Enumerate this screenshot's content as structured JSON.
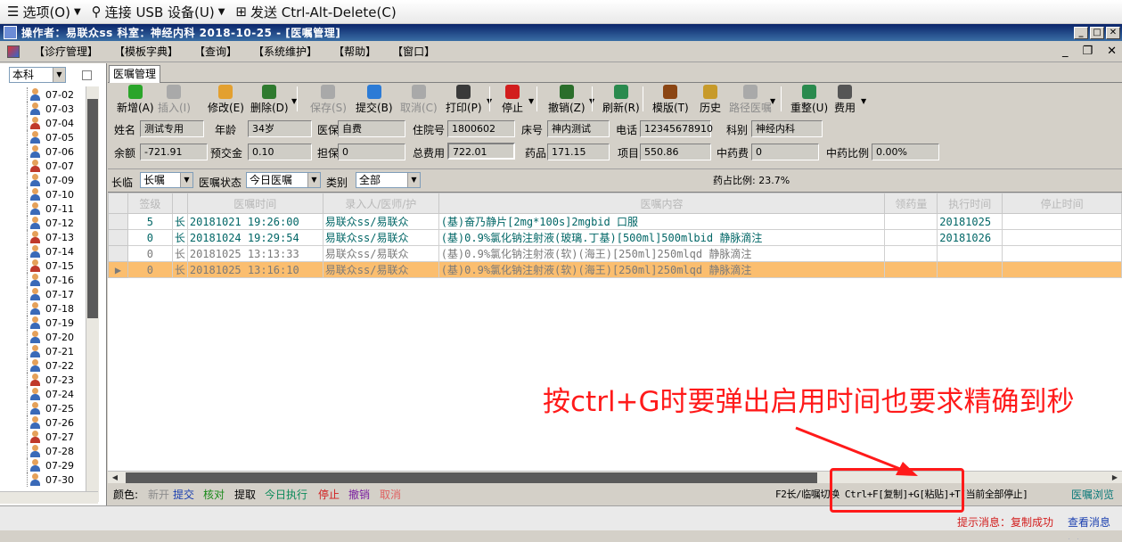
{
  "topbar": {
    "options_label": "选项(O)",
    "usb_label": "连接 USB 设备(U)",
    "send_label": "发送 Ctrl-Alt-Delete(C)"
  },
  "titlebar": {
    "text": "操作者：易联众ss  科室：神经内科  2018-10-25 - [医嘱管理]"
  },
  "menu": {
    "items": [
      "【诊疗管理】",
      "【模板字典】",
      "【查询】",
      "【系统维护】",
      "【帮助】",
      "【窗口】"
    ]
  },
  "left_panel": {
    "dept_combo": "本科",
    "items": [
      {
        "label": "07-02",
        "gender": "m"
      },
      {
        "label": "07-03",
        "gender": "m"
      },
      {
        "label": "07-04",
        "gender": "f"
      },
      {
        "label": "07-05",
        "gender": "m"
      },
      {
        "label": "07-06",
        "gender": "m"
      },
      {
        "label": "07-07",
        "gender": "f"
      },
      {
        "label": "07-09",
        "gender": "m"
      },
      {
        "label": "07-10",
        "gender": "m"
      },
      {
        "label": "07-11",
        "gender": "m"
      },
      {
        "label": "07-12",
        "gender": "m"
      },
      {
        "label": "07-13",
        "gender": "f"
      },
      {
        "label": "07-14",
        "gender": "m"
      },
      {
        "label": "07-15",
        "gender": "f"
      },
      {
        "label": "07-16",
        "gender": "m"
      },
      {
        "label": "07-17",
        "gender": "m"
      },
      {
        "label": "07-18",
        "gender": "m"
      },
      {
        "label": "07-19",
        "gender": "m"
      },
      {
        "label": "07-20",
        "gender": "m"
      },
      {
        "label": "07-21",
        "gender": "m"
      },
      {
        "label": "07-22",
        "gender": "m"
      },
      {
        "label": "07-23",
        "gender": "f"
      },
      {
        "label": "07-24",
        "gender": "m"
      },
      {
        "label": "07-25",
        "gender": "m"
      },
      {
        "label": "07-26",
        "gender": "m"
      },
      {
        "label": "07-27",
        "gender": "f"
      },
      {
        "label": "07-28",
        "gender": "m"
      },
      {
        "label": "07-29",
        "gender": "m"
      },
      {
        "label": "07-30",
        "gender": "m"
      }
    ]
  },
  "tab": {
    "label": "医嘱管理"
  },
  "toolbar": {
    "buttons": [
      {
        "label": "新增(A)",
        "icon": "add-icon",
        "color": "#2aa52a",
        "disabled": false,
        "drop": false
      },
      {
        "label": "插入(I)",
        "icon": "insert-icon",
        "color": "#a9a9a9",
        "disabled": true,
        "drop": false
      },
      {
        "label": "修改(E)",
        "icon": "edit-icon",
        "color": "#e3a030",
        "disabled": false,
        "drop": false
      },
      {
        "label": "删除(D)",
        "icon": "delete-icon",
        "color": "#2f7a2f",
        "disabled": false,
        "drop": true
      },
      {
        "label": "保存(S)",
        "icon": "save-icon",
        "color": "#a9a9a9",
        "disabled": true,
        "drop": false
      },
      {
        "label": "提交(B)",
        "icon": "submit-icon",
        "color": "#2c7bd6",
        "disabled": false,
        "drop": false
      },
      {
        "label": "取消(C)",
        "icon": "cancel-icon",
        "color": "#a9a9a9",
        "disabled": true,
        "drop": false
      },
      {
        "label": "打印(P)",
        "icon": "print-icon",
        "color": "#3a3a3a",
        "disabled": false,
        "drop": true
      },
      {
        "label": "停止",
        "icon": "stop-icon",
        "color": "#d21d1d",
        "disabled": false,
        "drop": true
      },
      {
        "label": "撤销(Z)",
        "icon": "undo-icon",
        "color": "#2b6e2b",
        "disabled": false,
        "drop": true
      },
      {
        "label": "刷新(R)",
        "icon": "refresh-icon",
        "color": "#2a8a4e",
        "disabled": false,
        "drop": false
      },
      {
        "label": "模版(T)",
        "icon": "template-icon",
        "color": "#8b4513",
        "disabled": false,
        "drop": false
      },
      {
        "label": "历史",
        "icon": "history-icon",
        "color": "#c79a2a",
        "disabled": false,
        "drop": false
      },
      {
        "label": "路径医嘱",
        "icon": "path-icon",
        "color": "#a9a9a9",
        "disabled": true,
        "drop": true
      },
      {
        "label": "重整(U)",
        "icon": "reorg-icon",
        "color": "#2a8a4e",
        "disabled": false,
        "drop": false
      },
      {
        "label": "费用",
        "icon": "fee-icon",
        "color": "#555555",
        "disabled": false,
        "drop": true
      }
    ]
  },
  "patient": {
    "name_label": "姓名",
    "name": "测试专用",
    "age_label": "年龄",
    "age": "34岁",
    "insurance_label": "医保",
    "insurance": "自费",
    "admission_label": "住院号",
    "admission": "1800602",
    "bed_label": "床号",
    "bed": "神内测试",
    "phone_label": "电话",
    "phone": "12345678910",
    "dept_label": "科别",
    "dept": "神经内科",
    "balance_label": "余额",
    "balance": "-721.91",
    "prepay_label": "预交金",
    "prepay": "0.10",
    "guarantee_label": "担保",
    "guarantee": "0",
    "total_label": "总费用",
    "total": "722.01",
    "drug_label": "药品",
    "drug": "171.15",
    "item_label": "项目",
    "item": "550.86",
    "tcm_label": "中药费",
    "tcm": "0",
    "tcm_ratio_label": "中药比例",
    "tcm_ratio": "0.00%"
  },
  "filters": {
    "type_label": "长临",
    "type_value": "长嘱",
    "status_label": "医嘱状态",
    "status_value": "今日医嘱",
    "category_label": "类别",
    "category_value": "全部",
    "ratio_text": "药占比例: 23.7%"
  },
  "grid": {
    "headers": [
      "签级",
      "医嘱时间",
      "录入人/医师/护",
      "医嘱内容",
      "领药量",
      "执行时间",
      "停止时间"
    ],
    "rows": [
      {
        "level": "5",
        "kind": "长",
        "time": "20181021 19:26:00",
        "entry": "易联众ss/易联众",
        "content": "(基)奋乃静片[2mg*100s]2mgbid 口服",
        "qty": "",
        "exec": "20181025",
        "stop": ""
      },
      {
        "level": "0",
        "kind": "长",
        "time": "20181024 19:29:54",
        "entry": "易联众ss/易联众",
        "content": "(基)0.9%氯化钠注射液(玻璃.丁基)[500ml]500mlbid 静脉滴注",
        "qty": "",
        "exec": "20181026",
        "stop": ""
      },
      {
        "level": "0",
        "kind": "长",
        "time": "20181025 13:13:33",
        "entry": "易联众ss/易联众",
        "content": "(基)0.9%氯化钠注射液(软)(海王)[250ml]250mlqd 静脉滴注",
        "qty": "",
        "exec": "",
        "stop": ""
      },
      {
        "level": "0",
        "kind": "长",
        "time": "20181025 13:16:10",
        "entry": "易联众ss/易联众",
        "content": "(基)0.9%氯化钠注射液(软)(海王)[250ml]250mlqd 静脉滴注",
        "qty": "",
        "exec": "",
        "stop": ""
      }
    ]
  },
  "legend": {
    "color_label": "颜色:",
    "items": [
      {
        "label": "新开",
        "color": "#8c8c8c"
      },
      {
        "label": "提交",
        "color": "#1a3fb0"
      },
      {
        "label": "核对",
        "color": "#1a8a1a"
      },
      {
        "label": "提取",
        "color": "#000000"
      },
      {
        "label": "今日执行",
        "color": "#0a8a5a"
      },
      {
        "label": "停止",
        "color": "#d21d1d"
      },
      {
        "label": "撤销",
        "color": "#7a1fa0"
      },
      {
        "label": "取消",
        "color": "#e06060"
      }
    ],
    "hint": "F2长/临嘱切换 Ctrl+F[复制]+G[粘贴]+T[当前全部停止]",
    "browse": "医嘱浏览"
  },
  "status": {
    "message": "提示消息：复制成功",
    "view": "查看消息>>"
  },
  "annotation": {
    "text": "按ctrl+G时要弹出启用时间也要求精确到秒",
    "color": "#ff1a1a"
  }
}
